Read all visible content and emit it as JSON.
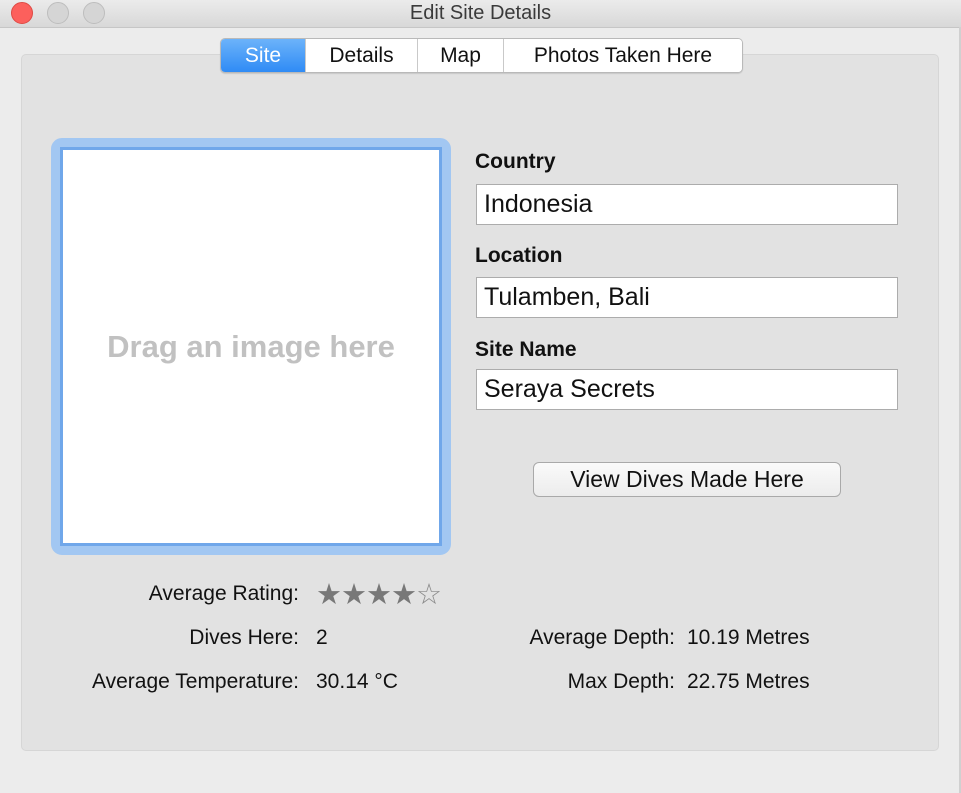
{
  "window": {
    "title": "Edit Site Details"
  },
  "tabs": [
    {
      "label": "Site",
      "active": true
    },
    {
      "label": "Details",
      "active": false
    },
    {
      "label": "Map",
      "active": false
    },
    {
      "label": "Photos Taken Here",
      "active": false
    }
  ],
  "image_drop": {
    "placeholder": "Drag an image here"
  },
  "fields": {
    "country": {
      "label": "Country",
      "value": "Indonesia"
    },
    "location": {
      "label": "Location",
      "value": "Tulamben, Bali"
    },
    "site_name": {
      "label": "Site Name",
      "value": "Seraya Secrets"
    }
  },
  "view_dives_button": "View Dives Made Here",
  "stats": {
    "average_rating": {
      "label": "Average Rating:",
      "value": 4,
      "max": 5
    },
    "dives_here": {
      "label": "Dives Here:",
      "value": "2"
    },
    "average_temperature": {
      "label": "Average Temperature:",
      "value": "30.14 °C"
    },
    "average_depth": {
      "label": "Average Depth:",
      "value": "10.19 Metres"
    },
    "max_depth": {
      "label": "Max Depth:",
      "value": "22.75 Metres"
    }
  },
  "colors": {
    "accent": "#2f8bf5",
    "close_button": "#fc605c",
    "dropzone_focus": "#70a7ea"
  },
  "icons": {
    "star_filled": "★",
    "star_empty": "☆"
  }
}
